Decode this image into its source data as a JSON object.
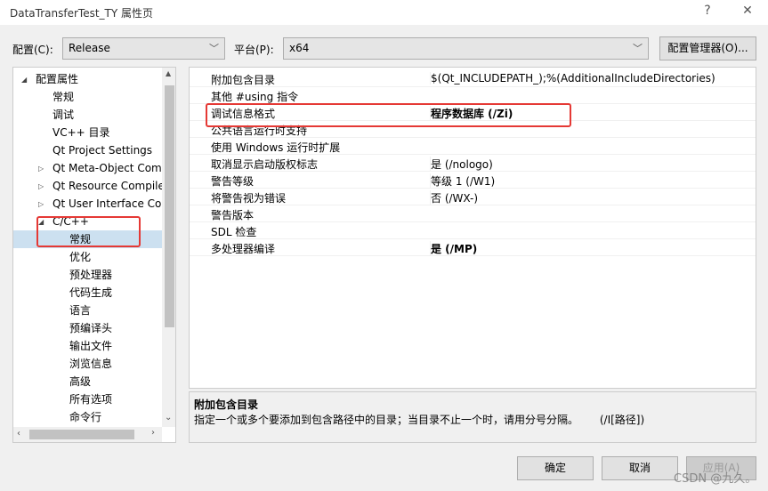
{
  "window": {
    "title": "DataTransferTest_TY 属性页",
    "help": "?",
    "close": "✕"
  },
  "toolbar": {
    "config_label": "配置(C):",
    "config_value": "Release",
    "platform_label": "平台(P):",
    "platform_value": "x64",
    "config_manager": "配置管理器(O)..."
  },
  "tree": {
    "items": [
      {
        "label": "配置属性",
        "level": 0,
        "expanded": true
      },
      {
        "label": "常规",
        "level": 1
      },
      {
        "label": "调试",
        "level": 1
      },
      {
        "label": "VC++ 目录",
        "level": 1
      },
      {
        "label": "Qt Project Settings",
        "level": 1
      },
      {
        "label": "Qt Meta-Object Com",
        "level": 1,
        "collapsed": true
      },
      {
        "label": "Qt Resource Compile",
        "level": 1,
        "collapsed": true
      },
      {
        "label": "Qt User Interface Cor",
        "level": 1,
        "collapsed": true
      },
      {
        "label": "C/C++",
        "level": 1,
        "expanded": true
      },
      {
        "label": "常规",
        "level": 2,
        "selected": true
      },
      {
        "label": "优化",
        "level": 2
      },
      {
        "label": "预处理器",
        "level": 2
      },
      {
        "label": "代码生成",
        "level": 2
      },
      {
        "label": "语言",
        "level": 2
      },
      {
        "label": "预编译头",
        "level": 2
      },
      {
        "label": "输出文件",
        "level": 2
      },
      {
        "label": "浏览信息",
        "level": 2
      },
      {
        "label": "高级",
        "level": 2
      },
      {
        "label": "所有选项",
        "level": 2
      },
      {
        "label": "命令行",
        "level": 2
      }
    ]
  },
  "grid": {
    "rows": [
      {
        "name": "附加包含目录",
        "value": "$(Qt_INCLUDEPATH_);%(AdditionalIncludeDirectories)",
        "bold": false
      },
      {
        "name": "其他 #using 指令",
        "value": "",
        "bold": false
      },
      {
        "name": "调试信息格式",
        "value": "程序数据库 (/Zi)",
        "bold": true
      },
      {
        "name": "公共语言运行时支持",
        "value": "",
        "bold": false
      },
      {
        "name": "使用 Windows 运行时扩展",
        "value": "",
        "bold": false
      },
      {
        "name": "取消显示启动版权标志",
        "value": "是 (/nologo)",
        "bold": false
      },
      {
        "name": "警告等级",
        "value": "等级 1 (/W1)",
        "bold": false
      },
      {
        "name": "将警告视为错误",
        "value": "否 (/WX-)",
        "bold": false
      },
      {
        "name": "警告版本",
        "value": "",
        "bold": false
      },
      {
        "name": "SDL 检查",
        "value": "",
        "bold": false
      },
      {
        "name": "多处理器编译",
        "value": "是 (/MP)",
        "bold": true
      }
    ]
  },
  "description": {
    "title": "附加包含目录",
    "text": "指定一个或多个要添加到包含路径中的目录；当目录不止一个时，请用分号分隔。",
    "switch": "(/I[路径])"
  },
  "buttons": {
    "ok": "确定",
    "cancel": "取消",
    "apply": "应用(A)"
  },
  "watermark": "CSDN @九久。",
  "colors": {
    "highlight": "#e53935",
    "selection": "#cce0f0"
  }
}
